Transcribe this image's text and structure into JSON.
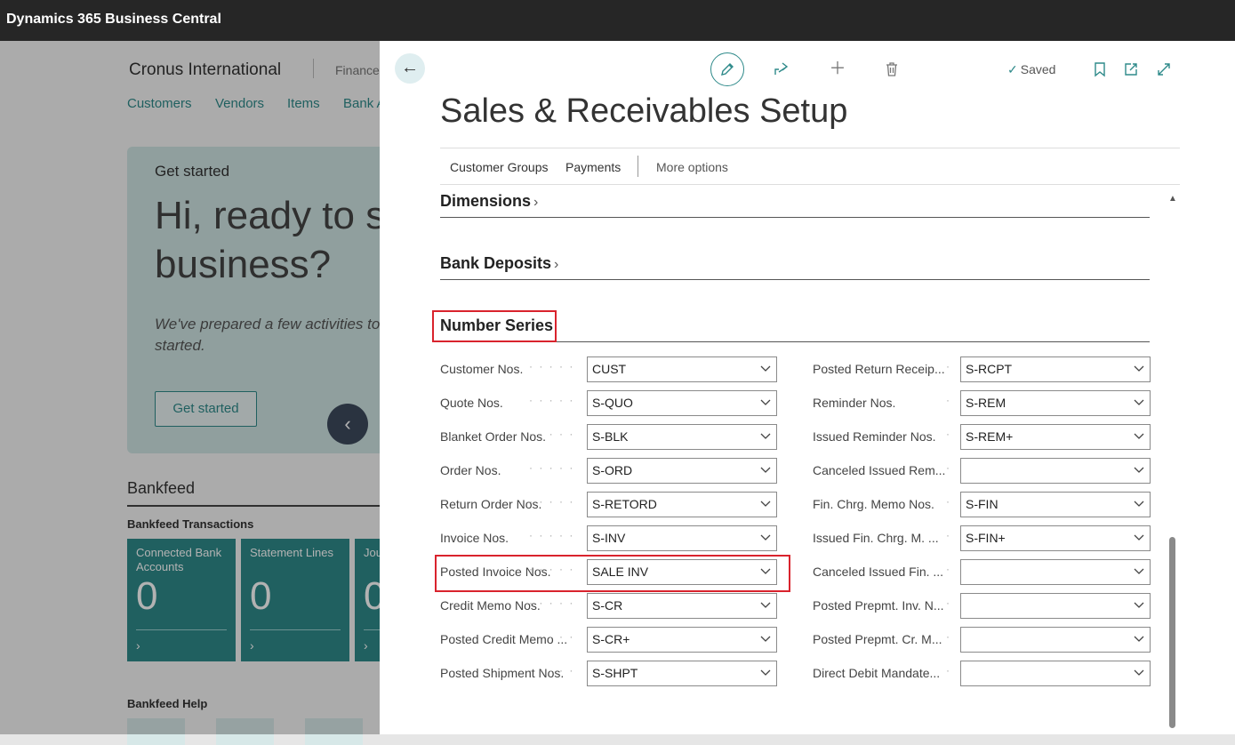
{
  "app": {
    "title": "Dynamics 365 Business Central"
  },
  "background": {
    "company": "Cronus International",
    "company_sub": "Finance",
    "nav": [
      "Customers",
      "Vendors",
      "Items",
      "Bank A"
    ],
    "hero": {
      "heading": "Get started",
      "title": "Hi, ready to s business?",
      "intro": "We've prepared a few activities to started.",
      "button": "Get started"
    },
    "section": "Bankfeed",
    "subsection": "Bankfeed Transactions",
    "tiles": [
      {
        "label": "Connected Bank Accounts",
        "value": "0"
      },
      {
        "label": "Statement Lines",
        "value": "0"
      },
      {
        "label": "Jou",
        "value": "0"
      }
    ],
    "help": "Bankfeed Help"
  },
  "panel": {
    "title": "Sales & Receivables Setup",
    "saved": "Saved",
    "actions": [
      "Customer Groups",
      "Payments",
      "More options"
    ],
    "fasttabs": [
      "Dimensions",
      "Bank Deposits",
      "Number Series"
    ],
    "left_fields": [
      {
        "label": "Customer Nos.",
        "value": "CUST"
      },
      {
        "label": "Quote Nos.",
        "value": "S-QUO"
      },
      {
        "label": "Blanket Order Nos.",
        "value": "S-BLK"
      },
      {
        "label": "Order Nos.",
        "value": "S-ORD"
      },
      {
        "label": "Return Order Nos.",
        "value": "S-RETORD"
      },
      {
        "label": "Invoice Nos.",
        "value": "S-INV"
      },
      {
        "label": "Posted Invoice Nos.",
        "value": "SALE INV"
      },
      {
        "label": "Credit Memo Nos.",
        "value": "S-CR"
      },
      {
        "label": "Posted Credit Memo ...",
        "value": "S-CR+"
      },
      {
        "label": "Posted Shipment Nos.",
        "value": "S-SHPT"
      }
    ],
    "right_fields": [
      {
        "label": "Posted Return Receip...",
        "value": "S-RCPT"
      },
      {
        "label": "Reminder Nos.",
        "value": "S-REM"
      },
      {
        "label": "Issued Reminder Nos.",
        "value": "S-REM+"
      },
      {
        "label": "Canceled Issued Rem...",
        "value": ""
      },
      {
        "label": "Fin. Chrg. Memo Nos.",
        "value": "S-FIN"
      },
      {
        "label": "Issued Fin. Chrg. M. ...",
        "value": "S-FIN+"
      },
      {
        "label": "Canceled Issued Fin. ...",
        "value": ""
      },
      {
        "label": "Posted Prepmt. Inv. N...",
        "value": ""
      },
      {
        "label": "Posted Prepmt. Cr. M...",
        "value": ""
      },
      {
        "label": "Direct Debit Mandate...",
        "value": ""
      }
    ]
  }
}
